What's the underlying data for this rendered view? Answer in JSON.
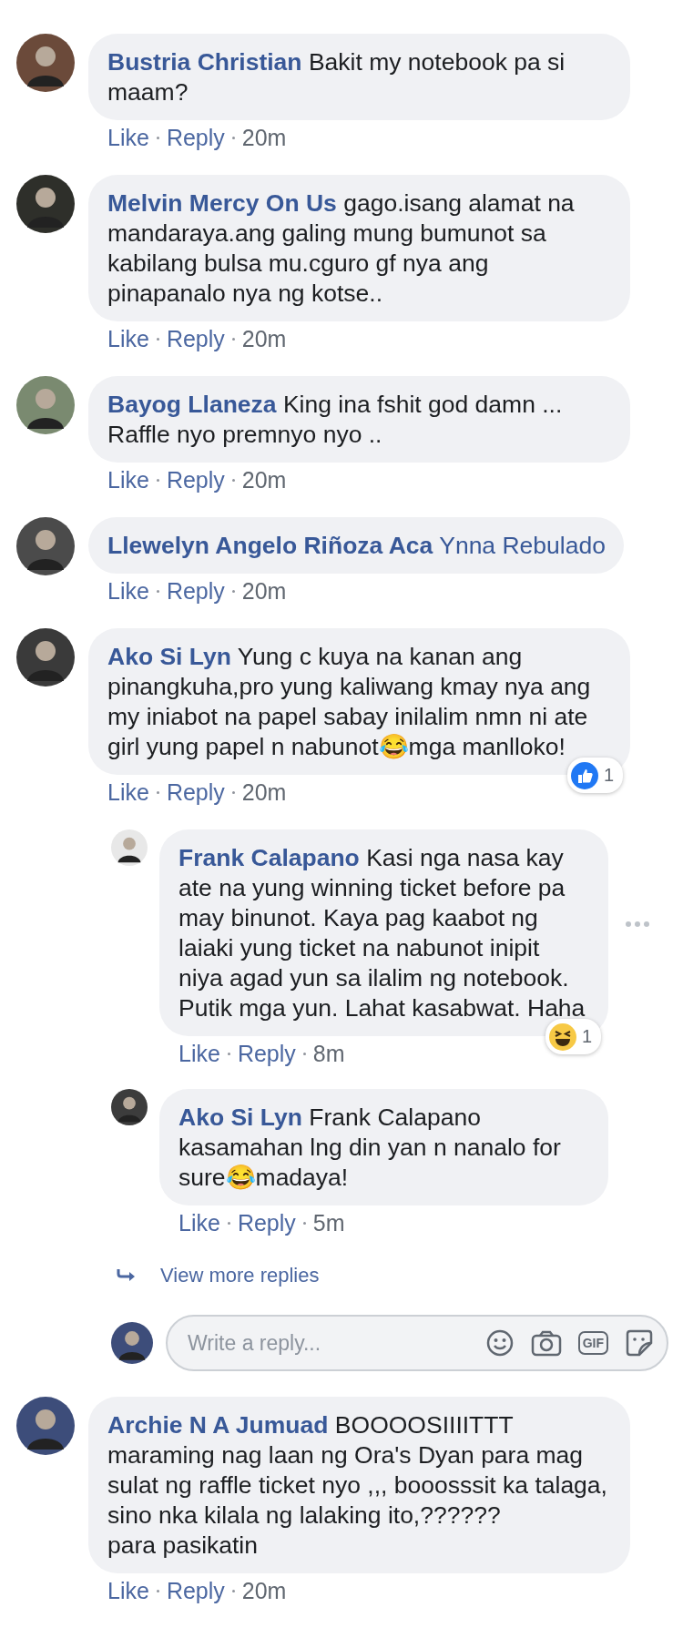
{
  "comments": [
    {
      "author": "Bustria Christian",
      "text": "Bakit my notebook pa si maam?",
      "actions": [
        "Like",
        "Reply"
      ],
      "time": "20m"
    },
    {
      "author": "Melvin Mercy On Us",
      "text": "gago.isang alamat na mandaraya.ang galing mung bumunot sa kabilang bulsa mu.cguro gf nya ang pinapanalo nya ng kotse..",
      "actions": [
        "Like",
        "Reply"
      ],
      "time": "20m"
    },
    {
      "author": "Bayog Llaneza",
      "text": "King ina fshit god damn ... Raffle nyo premnyo nyo ..",
      "actions": [
        "Like",
        "Reply"
      ],
      "time": "20m"
    },
    {
      "author": "Llewelyn Angelo Riñoza Aca",
      "mention": "Ynna Rebulado",
      "actions": [
        "Like",
        "Reply"
      ],
      "time": "20m"
    },
    {
      "author": "Ako Si Lyn",
      "text": "Yung c kuya na kanan ang pinangkuha,pro yung kaliwang kmay nya ang my iniabot na papel sabay inilalim nmn ni ate girl yung papel n nabunot😂mga manlloko!",
      "actions": [
        "Like",
        "Reply"
      ],
      "time": "20m",
      "reaction": {
        "kind": "like",
        "count": "1"
      },
      "replies": [
        {
          "author": "Frank Calapano",
          "text": "Kasi nga nasa kay ate na yung winning ticket before pa may binunot. Kaya pag kaabot ng laiaki yung ticket na nabunot inipit niya agad yun sa ilalim ng notebook. Putik mga yun. Lahat kasabwat. Haha",
          "actions": [
            "Like",
            "Reply"
          ],
          "time": "8m",
          "reaction": {
            "kind": "haha",
            "count": "1"
          },
          "menu_shown": true
        },
        {
          "author": "Ako Si Lyn",
          "text": "Frank Calapano kasamahan lng din yan n nanalo for sure😂madaya!",
          "actions": [
            "Like",
            "Reply"
          ],
          "time": "5m",
          "menu_shown": false
        }
      ],
      "more_replies": "View more replies",
      "reply_box": {
        "placeholder": "Write a reply...",
        "gif_label": "GIF"
      }
    },
    {
      "author": "Archie N A Jumuad",
      "text": "BOOOOSIIIITTT\nmaraming nag laan ng Ora's Dyan para mag sulat ng raffle ticket nyo ,,, booosssit ka talaga, sino nka kilala ng lalaking ito,??????\npara pasikatin",
      "actions": [
        "Like",
        "Reply"
      ],
      "time": "20m"
    }
  ]
}
